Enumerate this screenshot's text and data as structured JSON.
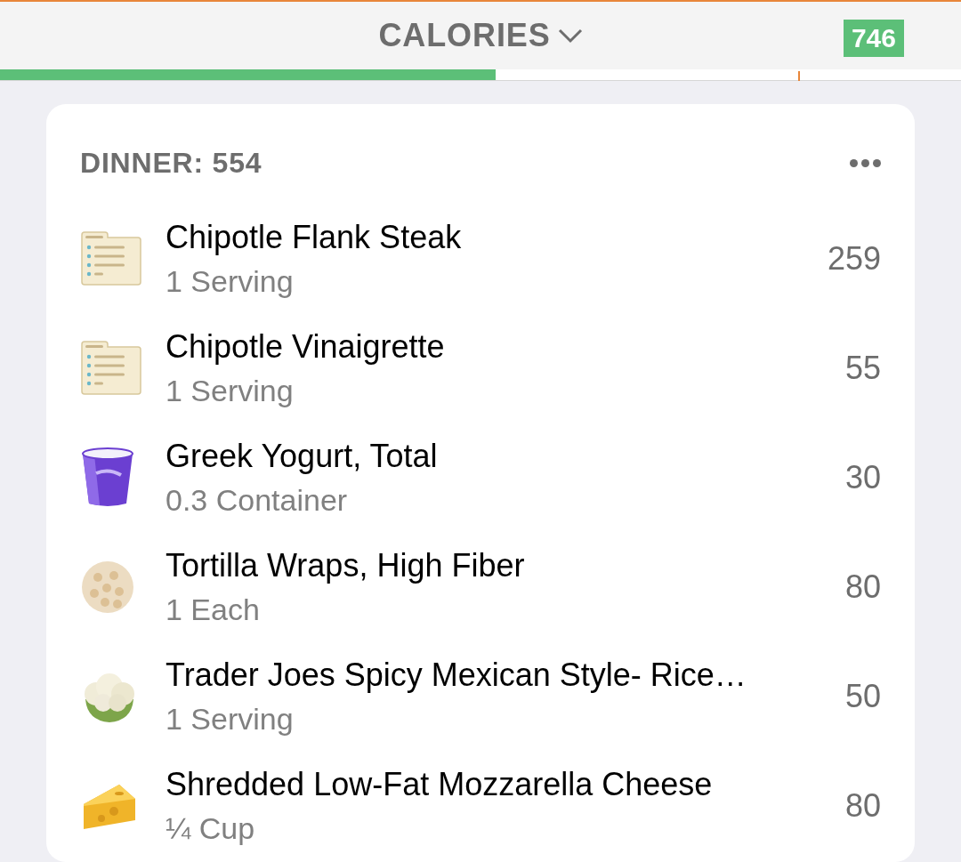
{
  "header": {
    "title": "CALORIES",
    "remaining": "746",
    "level": 0.516
  },
  "meal": {
    "title": "DINNER: 554",
    "items": [
      {
        "kind": "recipe",
        "name": "Chipotle Flank Steak",
        "serving": "1 Serving",
        "calories": "259"
      },
      {
        "kind": "recipe",
        "name": "Chipotle Vinaigrette",
        "serving": "1 Serving",
        "calories": "55"
      },
      {
        "kind": "yogurt",
        "name": "Greek Yogurt, Total",
        "serving": "0.3 Container",
        "calories": "30"
      },
      {
        "kind": "tortilla",
        "name": "Tortilla Wraps, High Fiber",
        "serving": "1 Each",
        "calories": "80"
      },
      {
        "kind": "cauliflower",
        "name": "Trader Joes Spicy Mexican Style- Rice…",
        "serving": "1 Serving",
        "calories": "50"
      },
      {
        "kind": "cheese",
        "name": "Shredded Low-Fat Mozzarella Cheese",
        "serving": "¼ Cup",
        "calories": "80"
      }
    ]
  }
}
